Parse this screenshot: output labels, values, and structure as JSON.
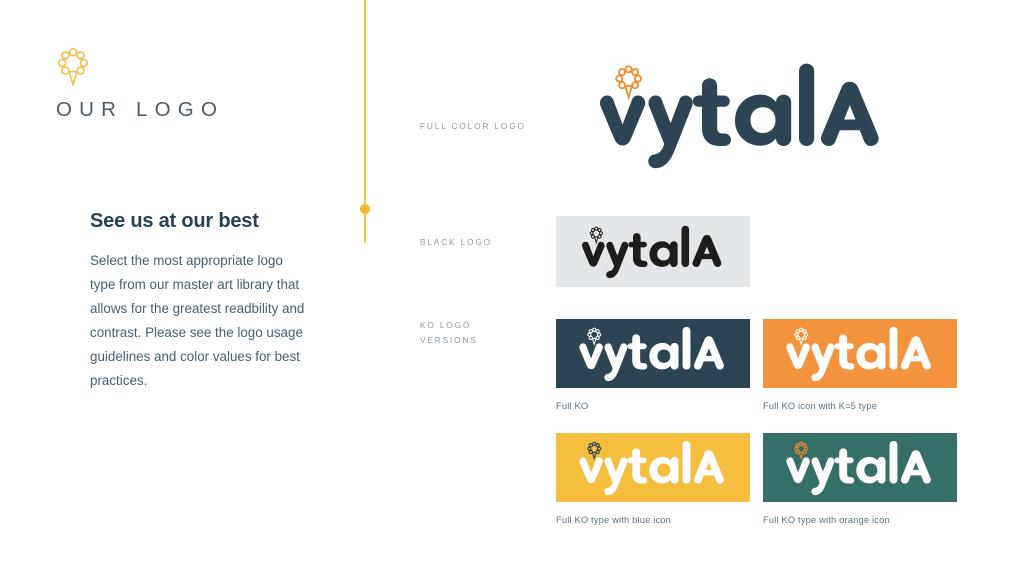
{
  "slide": {
    "title": "OUR LOGO",
    "background_color": "#ffffff"
  },
  "brand": {
    "wordmark": "vytala",
    "icon_name": "vytala-blossom-icon",
    "colors": {
      "navy": "#2d4452",
      "orange": "#f08a2b",
      "yellow": "#f5be3f",
      "teal": "#366e68",
      "orange_tile": "#f4933e",
      "light_gray_tile": "#e4e7e9",
      "divider_yellow": "#f5c344",
      "label_gray": "#8d9aa4",
      "body_text": "#46606e",
      "heading_text": "#27424f"
    }
  },
  "left_panel": {
    "heading": "See us at our best",
    "body": "Select the most appropriate logo type from our master art library that allows for the greatest readbility and contrast. Please see the logo usage guidelines and color values for best practices."
  },
  "sections": {
    "full_color": {
      "label": "FULL COLOR LOGO"
    },
    "black": {
      "label": "BLACK LOGO"
    },
    "ko": {
      "label": "KO LOGO\nVERSIONS"
    }
  },
  "swatches": [
    {
      "name": "full-color-logo",
      "caption": "",
      "background": "#ffffff",
      "type_color": "#2d4452",
      "icon_color": "#f08a2b"
    },
    {
      "name": "black-logo",
      "caption": "",
      "background": "#e4e7e9",
      "type_color": "#1d1d1b",
      "icon_color": "#1d1d1b"
    },
    {
      "name": "ko-dark",
      "caption": "Full KO",
      "background": "#2d4452",
      "type_color": "#ffffff",
      "icon_color": "#ffffff"
    },
    {
      "name": "ko-orange",
      "caption": "Full KO icon with K=5 type",
      "background": "#f4933e",
      "type_color": "#ffffff",
      "icon_color": "#ffffff"
    },
    {
      "name": "ko-yellow",
      "caption": "Full KO type with blue icon",
      "background": "#f5be3f",
      "type_color": "#ffffff",
      "icon_color": "#2d4452"
    },
    {
      "name": "ko-teal",
      "caption": "Full KO type with orange icon",
      "background": "#366e68",
      "type_color": "#ffffff",
      "icon_color": "#e8862c"
    }
  ]
}
